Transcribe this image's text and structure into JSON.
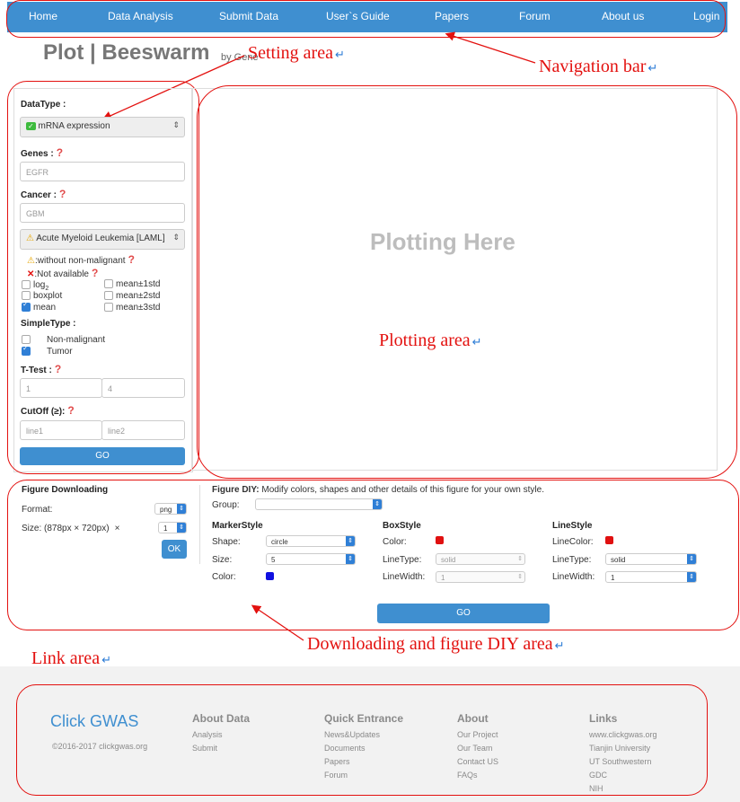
{
  "nav": {
    "items": [
      "Home",
      "Data Analysis",
      "Submit Data",
      "User`s Guide",
      "Papers",
      "Forum",
      "About us",
      "Login"
    ]
  },
  "page": {
    "title": "Plot | Beeswarm",
    "by": "by Gene"
  },
  "annotations": {
    "setting_area": "Setting area",
    "navigation_bar": "Navigation bar",
    "plotting_area": "Plotting area",
    "downloading_area": "Downloading and figure DIY area",
    "link_area": "Link area",
    "return_mark": "↵"
  },
  "settings": {
    "datatype_label": "DataType :",
    "datatype_value": "mRNA expression",
    "genes_label": "Genes :",
    "genes_placeholder": "EGFR",
    "cancer_label": "Cancer :",
    "cancer_placeholder": "GBM",
    "cancer_select": "Acute Myeloid Leukemia [LAML]",
    "legend_warn": ":without non-malignant",
    "legend_na": ":Not available",
    "checks": [
      {
        "label": "log",
        "sub": "2",
        "checked": false
      },
      {
        "label": "mean±1std",
        "checked": false
      },
      {
        "label": "boxplot",
        "checked": false
      },
      {
        "label": "mean±2std",
        "checked": false
      },
      {
        "label": "mean",
        "checked": true
      },
      {
        "label": "mean±3std",
        "checked": false
      }
    ],
    "simpletype_label": "SimpleType :",
    "simpletype": [
      {
        "label": "Non-malignant",
        "checked": false
      },
      {
        "label": "Tumor",
        "checked": true
      }
    ],
    "ttest_label": "T-Test :",
    "ttest_values": [
      "1",
      "4"
    ],
    "cutoff_label": "CutOff (≥):",
    "cutoff_placeholders": [
      "line1",
      "line2"
    ],
    "go": "GO",
    "help_mark": "?"
  },
  "plot": {
    "placeholder": "Plotting Here"
  },
  "download": {
    "title": "Figure Downloading",
    "format_label": "Format:",
    "format_value": "png",
    "size_label": "Size: (878px × 720px)",
    "times": "×",
    "size_value": "1",
    "ok": "OK"
  },
  "diy": {
    "title": "Figure DIY:",
    "desc": "Modify colors, shapes and other details of this figure for your own style.",
    "group_label": "Group:",
    "marker": {
      "title": "MarkerStyle",
      "shape_label": "Shape:",
      "shape": "circle",
      "size_label": "Size:",
      "size": "5",
      "color_label": "Color:",
      "color": "#1010e0"
    },
    "box": {
      "title": "BoxStyle",
      "color_label": "Color:",
      "color": "#e01010",
      "linetype_label": "LineType:",
      "linetype": "solid",
      "linewidth_label": "LineWidth:",
      "linewidth": "1"
    },
    "line": {
      "title": "LineStyle",
      "linecolor_label": "LineColor:",
      "linecolor": "#e01010",
      "linetype_label": "LineType:",
      "linetype": "solid",
      "linewidth_label": "LineWidth:",
      "linewidth": "1"
    },
    "go": "GO"
  },
  "footer": {
    "brand": "Click GWAS",
    "copyright": "©2016-2017 clickgwas.org",
    "about_data": {
      "title": "About Data",
      "links": [
        "Analysis",
        "Submit"
      ]
    },
    "quick": {
      "title": "Quick Entrance",
      "links": [
        "News&Updates",
        "Documents",
        "Papers",
        "Forum"
      ]
    },
    "about": {
      "title": "About",
      "links": [
        "Our Project",
        "Our Team",
        "Contact US",
        "FAQs"
      ]
    },
    "links": {
      "title": "Links",
      "links": [
        "www.clickgwas.org",
        "Tianjin University",
        "UT Southwestern",
        "GDC",
        "NIH"
      ]
    }
  },
  "colors": {
    "nav": "#3f8fd0",
    "annotation": "#e3110f"
  }
}
